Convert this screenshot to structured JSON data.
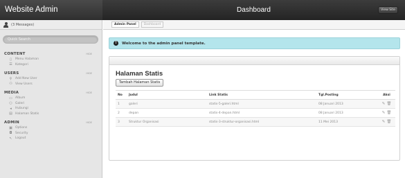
{
  "app": {
    "title": "Website Admin"
  },
  "header": {
    "title": "Dashboard",
    "view_site": "View Site"
  },
  "sidebar": {
    "messages": "(3 Messages)",
    "search_placeholder": "Quick Search",
    "hide_label": "HIDE",
    "sections": [
      {
        "title": "CONTENT",
        "items": [
          {
            "icon": "document-icon",
            "glyph": "▯",
            "label": "Menu Halaman"
          },
          {
            "icon": "list-icon",
            "glyph": "☰",
            "label": "Kategori"
          }
        ]
      },
      {
        "title": "USERS",
        "items": [
          {
            "icon": "user-add-icon",
            "glyph": "⚲",
            "label": "Add New User"
          },
          {
            "icon": "users-icon",
            "glyph": "⚇",
            "label": "View Users"
          }
        ]
      },
      {
        "title": "MEDIA",
        "items": [
          {
            "icon": "folder-icon",
            "glyph": "▭",
            "label": "Album"
          },
          {
            "icon": "circle-icon",
            "glyph": "○",
            "label": "Galeri"
          },
          {
            "icon": "speaker-icon",
            "glyph": "◂",
            "label": "Hubungi"
          },
          {
            "icon": "page-icon",
            "glyph": "▤",
            "label": "Halaman Statis"
          }
        ]
      },
      {
        "title": "ADMIN",
        "items": [
          {
            "icon": "options-icon",
            "glyph": "▣",
            "label": "Options"
          },
          {
            "icon": "lock-icon",
            "glyph": "◘",
            "label": "Security"
          },
          {
            "icon": "logout-icon",
            "glyph": "↖",
            "label": "Logout"
          }
        ]
      }
    ]
  },
  "tabs": [
    {
      "label": "Admin Panel",
      "active": true
    },
    {
      "label": "Dashboard",
      "active": false
    }
  ],
  "alert": {
    "text": "Welcome to the admin panel template."
  },
  "panel": {
    "title": "Halaman Statis",
    "add_button": "Tambah Halaman Statis",
    "columns": [
      "No",
      "Judul",
      "Link Statis",
      "Tgl.Posting",
      "Aksi"
    ],
    "rows": [
      [
        "1",
        "galeri",
        "statis-5-galeri.html",
        "08 Januari 2013"
      ],
      [
        "2",
        "depan",
        "statis-4-depan.html",
        "08 Januari 2013"
      ],
      [
        "3",
        "Struktur Organisasi",
        "statis-3-struktur-organisasi.html",
        "11 Mei 2013"
      ]
    ]
  },
  "colors": {
    "alert_bg": "#b4e5ec",
    "topbar": "#2c2c2c",
    "sidebar_bg": "#e6e6e6"
  }
}
